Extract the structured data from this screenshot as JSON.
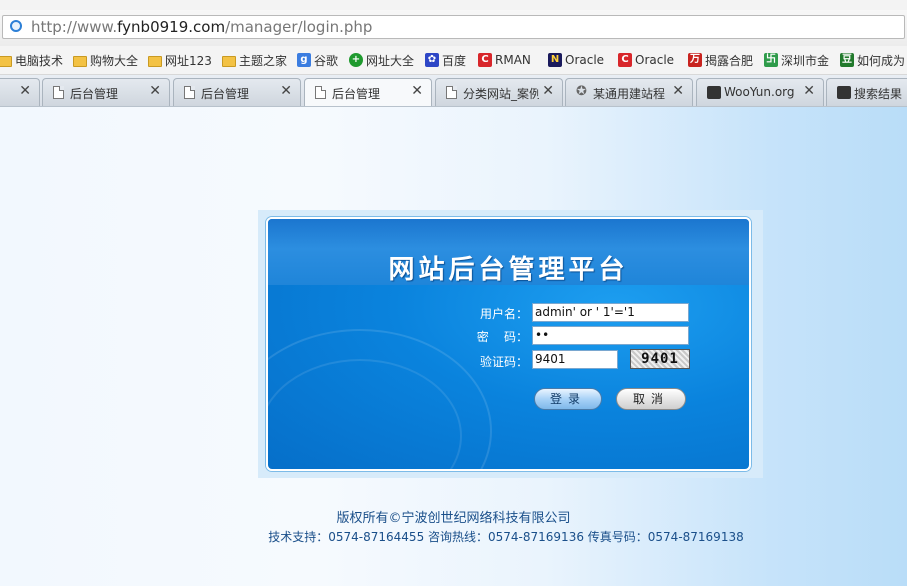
{
  "browser": {
    "address": {
      "scheme": "http://www.",
      "host": "fynb0919.com",
      "path": "/manager/login.php"
    },
    "bookmarks": [
      {
        "label": "电脑技术",
        "icon": "folder-icon"
      },
      {
        "label": "购物大全",
        "icon": "folder-icon"
      },
      {
        "label": "网址123",
        "icon": "folder-icon"
      },
      {
        "label": "主题之家",
        "icon": "folder-icon"
      },
      {
        "label": "谷歌",
        "icon": "google-icon"
      },
      {
        "label": "网址大全",
        "icon": "plus-globe-icon"
      },
      {
        "label": "百度",
        "icon": "baidu-paw-icon"
      },
      {
        "label": "RMAN",
        "icon": "c-logo-icon"
      },
      {
        "label": "Oracle",
        "icon": "n-logo-icon"
      },
      {
        "label": "Oracle",
        "icon": "c-logo-icon"
      },
      {
        "label": "揭露合肥",
        "icon": "wan-logo-icon"
      },
      {
        "label": "深圳市金",
        "icon": "green-logo-icon"
      },
      {
        "label": "如何成为",
        "icon": "dou-logo-icon"
      }
    ],
    "tabs": [
      {
        "label": "",
        "icon": "none"
      },
      {
        "label": "后台管理",
        "icon": "page-icon"
      },
      {
        "label": "后台管理",
        "icon": "page-icon"
      },
      {
        "label": "后台管理",
        "icon": "page-icon"
      },
      {
        "label": "分类网站_案例",
        "icon": "page-icon"
      },
      {
        "label": "某通用建站程",
        "icon": "star-icon"
      },
      {
        "label": "WooYun.org",
        "icon": "wooyun-icon"
      },
      {
        "label": "搜索结果",
        "icon": "wooyun-icon"
      }
    ],
    "active_tab": 3
  },
  "login": {
    "title": "网站后台管理平台",
    "username_label": "用户名：",
    "username_value": "admin' or ' 1'='1",
    "password_label": "密    码：",
    "password_value": "••",
    "captcha_label": "验证码：",
    "captcha_value": "9401",
    "captcha_image_text": "9401",
    "login_button": "登录",
    "cancel_button": "取消"
  },
  "footer": {
    "copyright": "版权所有©宁波创世纪网络科技有限公司",
    "contacts": "技术支持：0574-87164455 咨询热线：0574-87169136 传真号码：0574-87169138"
  },
  "colors": {
    "panel_blue": "#0a83dd",
    "header_blue": "#1f85d9",
    "footer_text": "#1a4f8a",
    "page_bg_right": "#b9ddf8"
  }
}
